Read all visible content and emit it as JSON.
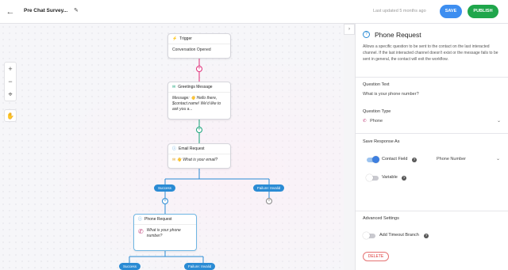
{
  "header": {
    "title": "Pre Chat Survey...",
    "last_updated": "Last updated 5 months ago",
    "save_label": "SAVE",
    "publish_label": "PUBLISH"
  },
  "toolbar": {
    "zoom_in": "+",
    "zoom_out": "−",
    "fit": "⌖",
    "hand": "✋"
  },
  "nodes": {
    "trigger": {
      "title": "Trigger",
      "body": "Conversation Opened"
    },
    "greetings": {
      "title": "Greetings Message",
      "body": "Message: 👋 Hello there, $contact.name! We'd like to ask you a..."
    },
    "email": {
      "title": "Email Request",
      "body": "👋 What is your email?"
    },
    "phone": {
      "title": "Phone Request",
      "body": "What is your phone number?"
    }
  },
  "tags": {
    "success1": "Success",
    "failure1": "Failure: Invalid",
    "success2": "Success",
    "failure2": "Failure: Invalid"
  },
  "panel": {
    "title": "Phone Request",
    "description": "Allows a specific question to be sent to the contact on the last interacted channel. If the last interacted channel doesn't exist or the message fails to be sent in general, the contact will exit the workflow.",
    "question_text_label": "Question Text",
    "question_text_value": "What is your phone number?",
    "question_type_label": "Question Type",
    "question_type_value": "Phone",
    "save_response_label": "Save Response As",
    "contact_field_label": "Contact Field",
    "contact_field_value": "Phone Number",
    "variable_label": "Variable",
    "advanced_label": "Advanced Settings",
    "timeout_label": "Add Timeout Branch",
    "delete_label": "DELETE",
    "contact_field_on": true,
    "variable_on": false,
    "timeout_on": false
  },
  "colors": {
    "accent": "#3d8ef0",
    "publish": "#1fa64b",
    "branch": "#2a8bd4",
    "trigger_line": "#e0307a",
    "action_line": "#1aa37a"
  }
}
